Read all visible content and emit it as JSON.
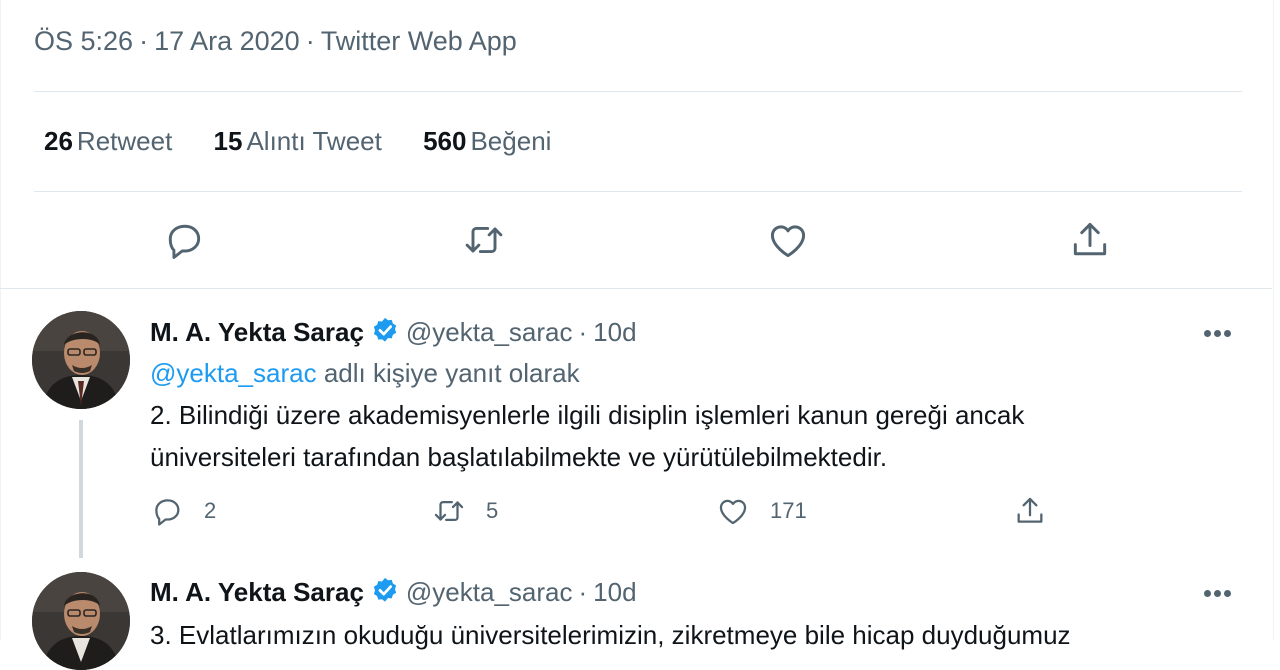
{
  "tweet_meta": {
    "time": "ÖS 5:26",
    "date": "17 Ara 2020",
    "source": "Twitter Web App"
  },
  "stats": [
    {
      "count": "26",
      "label": "Retweet"
    },
    {
      "count": "15",
      "label": "Alıntı Tweet"
    },
    {
      "count": "560",
      "label": "Beğeni"
    }
  ],
  "main_actions": {
    "icons": [
      "reply-icon",
      "retweet-icon",
      "like-icon",
      "share-icon"
    ]
  },
  "replies": [
    {
      "name": "M. A. Yekta Saraç",
      "handle": "@yekta_sarac",
      "time": "10d",
      "replying_prefix": "",
      "replying_mention": "@yekta_sarac",
      "replying_suffix": "adlı kişiye yanıt olarak",
      "lines": [
        "2. Bilindiği üzere akademisyenlerle ilgili disiplin işlemleri kanun gereği ancak",
        "üniversiteleri tarafından başlatılabilmekte ve yürütülebilmektedir."
      ],
      "reply_count": "2",
      "retweet_count": "5",
      "like_count": "171"
    },
    {
      "name": "M. A. Yekta Saraç",
      "handle": "@yekta_sarac",
      "time": "10d",
      "lines": [
        "3. Evlatlarımızın okuduğu üniversitelerimizin, zikretmeye bile hicap duyduğumuz"
      ]
    }
  ],
  "colors": {
    "accent": "#1d9bf0",
    "secondary_text": "#536471",
    "divider": "#e1e8ed"
  }
}
